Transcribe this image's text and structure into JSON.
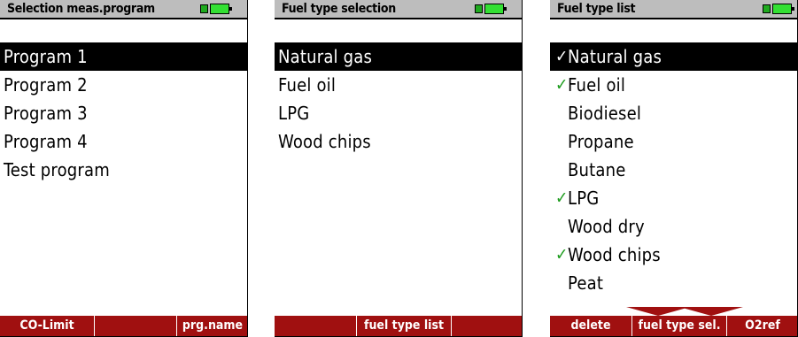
{
  "colors": {
    "softkey_bg": "#a01010",
    "titlebar_bg": "#bdbdbd",
    "check": "#1e9c1e",
    "battery": "#33e033"
  },
  "screen1": {
    "title": "Selection meas.program",
    "items": [
      "Program 1",
      "Program 2",
      "Program 3",
      "Program 4",
      "Test program"
    ],
    "selected_index": 0,
    "softkeys": {
      "left": "CO-Limit",
      "middle": "",
      "right": "prg.name"
    }
  },
  "screen2": {
    "title": "Fuel type selection",
    "items": [
      "Natural gas",
      "Fuel oil",
      "LPG",
      "Wood chips"
    ],
    "selected_index": 0,
    "softkeys": {
      "left": "",
      "middle": "fuel type list",
      "right": ""
    }
  },
  "screen3": {
    "title": "Fuel type list",
    "check_mark": "✓",
    "items": [
      {
        "label": "Natural gas",
        "checked": true
      },
      {
        "label": "Fuel oil",
        "checked": true
      },
      {
        "label": "Biodiesel",
        "checked": false
      },
      {
        "label": "Propane",
        "checked": false
      },
      {
        "label": "Butane",
        "checked": false
      },
      {
        "label": "LPG",
        "checked": true
      },
      {
        "label": "Wood dry",
        "checked": false
      },
      {
        "label": "Wood chips",
        "checked": true
      },
      {
        "label": "Peat",
        "checked": false
      }
    ],
    "selected_index": 0,
    "softkeys": {
      "left": "delete",
      "middle": "fuel type sel.",
      "right": "O2ref"
    }
  }
}
